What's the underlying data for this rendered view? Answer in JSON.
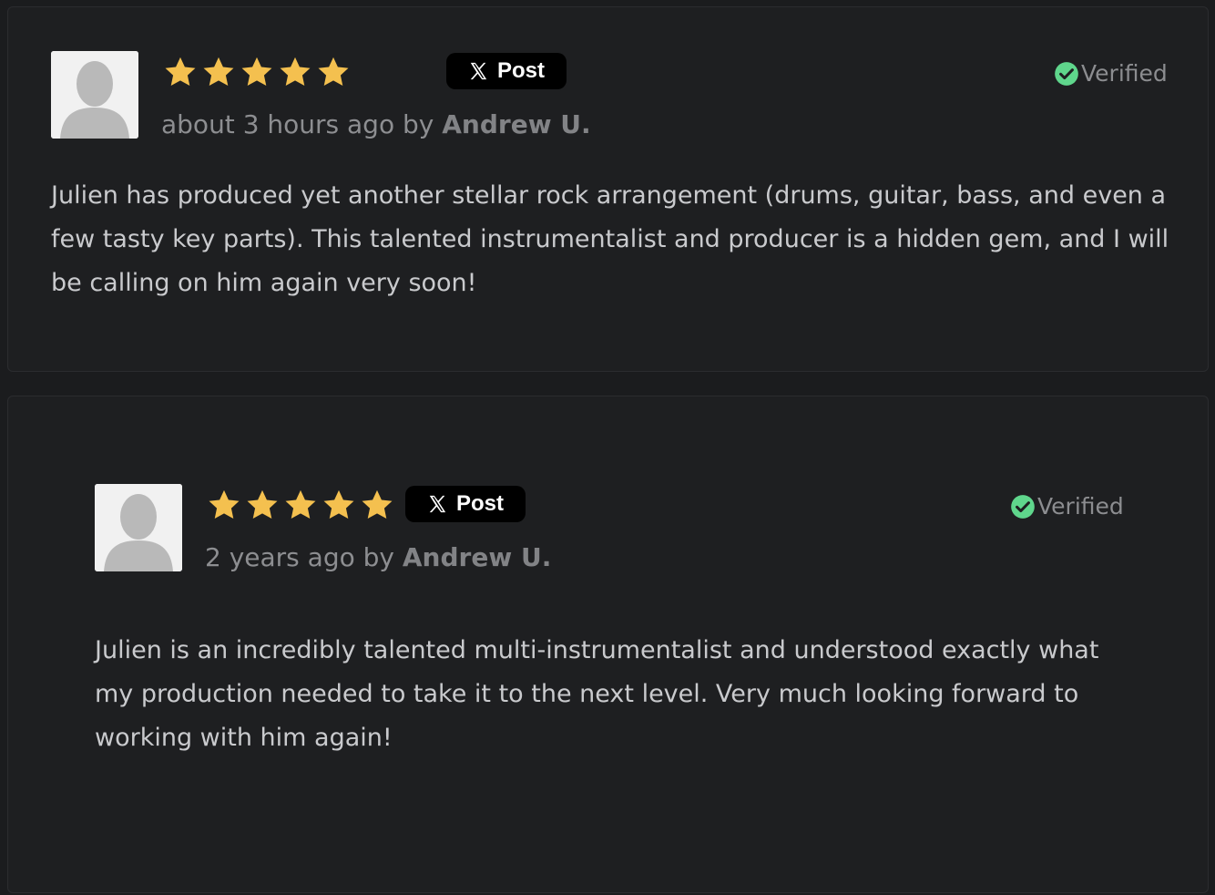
{
  "colors": {
    "page_bg": "#1b1c1e",
    "card_bg": "#1e1f21",
    "star": "#f4c04f",
    "verified_check": "#5fd68c",
    "post_button": "#000000"
  },
  "reviews": [
    {
      "rating": 5,
      "post_label": "Post",
      "verified_label": "Verified",
      "time_ago": "about 3 hours ago",
      "by_word": " by ",
      "author": "Andrew U.",
      "text": "Julien has produced yet another stellar rock arrangement (drums, guitar, bass, and even a few tasty key parts). This talented instrumentalist and producer is a hidden gem, and I will be calling on him again very soon!",
      "icons": {
        "avatar": "user-silhouette-icon",
        "verified": "check-circle-icon",
        "post": "x-logo-icon"
      }
    },
    {
      "rating": 5,
      "post_label": "Post",
      "verified_label": "Verified",
      "time_ago": "2 years ago",
      "by_word": " by ",
      "author": "Andrew U.",
      "text": "Julien is an incredibly talented multi-instrumentalist and understood exactly what my production needed to take it to the next level. Very much looking forward to working with him again!",
      "icons": {
        "avatar": "user-silhouette-icon",
        "verified": "check-circle-icon",
        "post": "x-logo-icon"
      }
    }
  ]
}
